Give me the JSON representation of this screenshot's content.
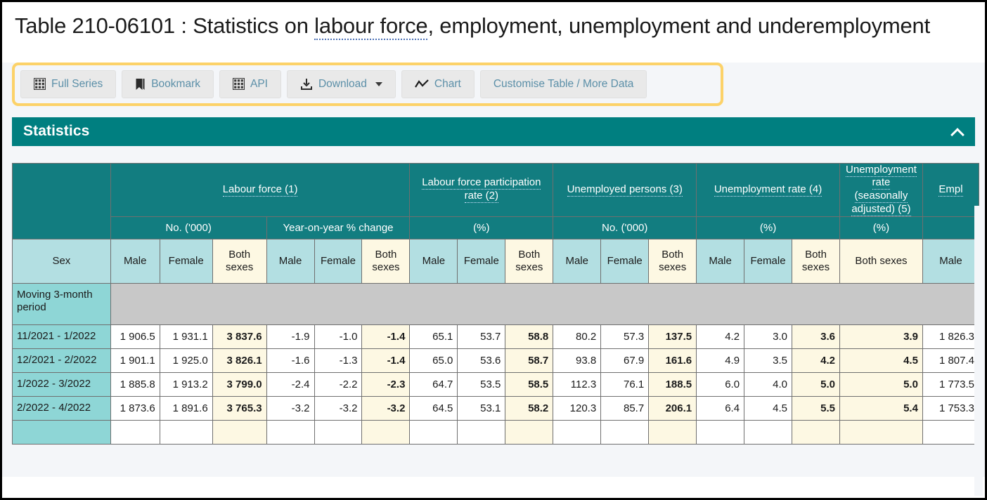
{
  "page": {
    "title_line1": "Table 210-06101 : Statistics on labour force, employment, unemployment and",
    "title_line2": "underemployment",
    "title_link_text": "labour force"
  },
  "colors": {
    "teal_header": "#127d80",
    "teal_bar": "#007f80",
    "light_cyan": "#b3dfe2",
    "row_label_cyan": "#8ed6d6",
    "highlight_cream": "#fdf8e3",
    "outline_yellow": "#fcd269",
    "disabled_gray": "#c8c8c8",
    "button_text": "#5b8fa8"
  },
  "toolbar": {
    "buttons": [
      {
        "label": "Full Series",
        "icon": "grid-icon"
      },
      {
        "label": "Bookmark",
        "icon": "bookmark-icon"
      },
      {
        "label": "API",
        "icon": "grid-icon"
      },
      {
        "label": "Download",
        "icon": "download-icon",
        "caret": true
      },
      {
        "label": "Chart",
        "icon": "line-chart-icon"
      },
      {
        "label": "Customise Table / More Data",
        "icon": "none"
      }
    ]
  },
  "section": {
    "statistics_label": "Statistics",
    "collapse_icon": "chevron-up-icon"
  },
  "table": {
    "corner_label": "Sex",
    "row_group_label": "Moving 3-month period",
    "groups": [
      {
        "label": "Labour force (1)",
        "link": true,
        "span": 6
      },
      {
        "label": "Labour force participation rate (2)",
        "link": true,
        "span": 3
      },
      {
        "label": "Unemployed persons (3)",
        "link": true,
        "span": 3
      },
      {
        "label": "Unemployment rate (4)",
        "link": true,
        "span": 3
      },
      {
        "label": "Unemployment rate (seasonally adjusted) (5)",
        "link": true,
        "span": 1
      },
      {
        "label": "Empl",
        "link": true,
        "span": 1,
        "clipped": true
      }
    ],
    "units": [
      {
        "label": "No. ('000)",
        "span": 3
      },
      {
        "label": "Year-on-year % change",
        "span": 3
      },
      {
        "label": "(%)",
        "span": 3
      },
      {
        "label": "No. ('000)",
        "span": 3
      },
      {
        "label": "(%)",
        "span": 3
      },
      {
        "label": "(%)",
        "span": 1
      },
      {
        "label": "",
        "span": 1
      }
    ],
    "sex_headers": [
      {
        "label": "Male",
        "highlight": false
      },
      {
        "label": "Female",
        "highlight": false
      },
      {
        "label": "Both sexes",
        "highlight": true
      },
      {
        "label": "Male",
        "highlight": false
      },
      {
        "label": "Female",
        "highlight": false
      },
      {
        "label": "Both sexes",
        "highlight": true
      },
      {
        "label": "Male",
        "highlight": false
      },
      {
        "label": "Female",
        "highlight": false
      },
      {
        "label": "Both sexes",
        "highlight": true
      },
      {
        "label": "Male",
        "highlight": false
      },
      {
        "label": "Female",
        "highlight": false
      },
      {
        "label": "Both sexes",
        "highlight": true
      },
      {
        "label": "Male",
        "highlight": false
      },
      {
        "label": "Female",
        "highlight": false
      },
      {
        "label": "Both sexes",
        "highlight": true
      },
      {
        "label": "Both sexes",
        "highlight": true
      },
      {
        "label": "Male",
        "highlight": false
      }
    ],
    "rows": [
      {
        "period": "11/2021 - 1/2022",
        "values": [
          "1 906.5",
          "1 931.1",
          "3 837.6",
          "-1.9",
          "-1.0",
          "-1.4",
          "65.1",
          "53.7",
          "58.8",
          "80.2",
          "57.3",
          "137.5",
          "4.2",
          "3.0",
          "3.6",
          "3.9",
          "1 826.3"
        ]
      },
      {
        "period": "12/2021 - 2/2022",
        "values": [
          "1 901.1",
          "1 925.0",
          "3 826.1",
          "-1.6",
          "-1.3",
          "-1.4",
          "65.0",
          "53.6",
          "58.7",
          "93.8",
          "67.9",
          "161.6",
          "4.9",
          "3.5",
          "4.2",
          "4.5",
          "1 807.4"
        ]
      },
      {
        "period": "1/2022 - 3/2022",
        "values": [
          "1 885.8",
          "1 913.2",
          "3 799.0",
          "-2.4",
          "-2.2",
          "-2.3",
          "64.7",
          "53.5",
          "58.5",
          "112.3",
          "76.1",
          "188.5",
          "6.0",
          "4.0",
          "5.0",
          "5.0",
          "1 773.5"
        ]
      },
      {
        "period": "2/2022 - 4/2022",
        "values": [
          "1 873.6",
          "1 891.6",
          "3 765.3",
          "-3.2",
          "-3.2",
          "-3.2",
          "64.5",
          "53.1",
          "58.2",
          "120.3",
          "85.7",
          "206.1",
          "6.4",
          "4.5",
          "5.5",
          "5.4",
          "1 753.3"
        ]
      },
      {
        "period": "",
        "values": [
          "",
          "",
          "",
          "",
          "",
          "",
          "",
          "",
          "",
          "",
          "",
          "",
          "",
          "",
          "",
          "",
          ""
        ]
      }
    ],
    "highlight_columns": [
      2,
      5,
      8,
      11,
      14,
      15
    ]
  }
}
